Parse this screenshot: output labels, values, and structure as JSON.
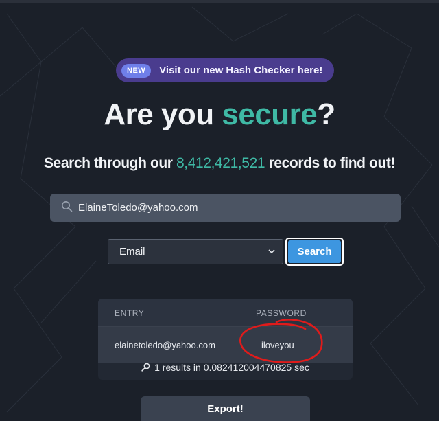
{
  "banner": {
    "tag": "NEW",
    "text": "Visit our new Hash Checker here!"
  },
  "headline": {
    "pre": "Are you ",
    "accent": "secure",
    "post": "?"
  },
  "subline": {
    "pre": "Search through our ",
    "count": "8,412,421,521",
    "post": " records to find out!"
  },
  "search": {
    "value": "ElaineToledo@yahoo.com",
    "icon": "search-icon"
  },
  "select": {
    "selected": "Email"
  },
  "search_button": {
    "label": "Search"
  },
  "results": {
    "headers": [
      "ENTRY",
      "PASSWORD"
    ],
    "rows": [
      {
        "entry": "elainetoledo@yahoo.com",
        "password": "iloveyou"
      }
    ],
    "summary": "1 results in 0.082412004470825 sec"
  },
  "export_button": {
    "label": "Export!"
  },
  "colors": {
    "accent": "#3fb9a5",
    "banner": "#4a3c8e",
    "button": "#3d96e0",
    "background": "#1b2029"
  }
}
